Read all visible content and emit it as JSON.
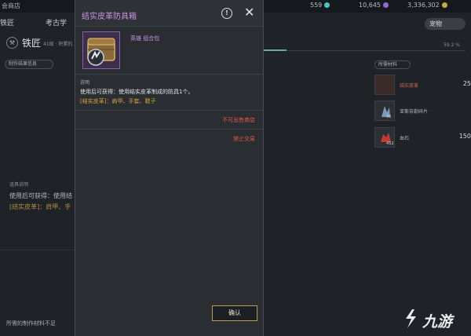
{
  "topbar": {
    "shop": "会商店",
    "resources": [
      {
        "value": "559",
        "color": "#4dc3c4"
      },
      {
        "value": "10,645",
        "color": "#8f6ad0"
      },
      {
        "value": "3,336,302",
        "color": "#c9a64a"
      }
    ]
  },
  "tabs": {
    "smith": "铁匠",
    "archaeology": "考古学",
    "pet": "宠物"
  },
  "smith": {
    "title": "铁匠",
    "level": "41级 · 积累的…",
    "icon": "⚒"
  },
  "result_button": "制作结果信息",
  "progress": {
    "percent_text": "59.2 %",
    "fraction": 0.592
  },
  "materials": {
    "header": "所需材料",
    "items": [
      {
        "name": "结实皮革",
        "count": "25",
        "qty": "",
        "name_color": "#d9635a"
      },
      {
        "name": "亚斯奈勒碎片",
        "count": "",
        "qty": "36",
        "name_color": "#b4b8bd"
      },
      {
        "name": "血石",
        "count": "150",
        "qty": "452",
        "name_color": "#b4b8bd"
      }
    ]
  },
  "background": {
    "desc_label": "道具说明",
    "line1": "使用后可获得：使用结",
    "line2": "[结实皮革]：肩甲、手",
    "bottom_notice": "所需的制作材料不足"
  },
  "modal": {
    "title": "结实皮革防具箱",
    "item_type": "英雄 组合包",
    "desc_label": "说明",
    "desc_line1": "使用后可获得：使用结实皮革制成的防具1个。",
    "desc_line2": "[结实皮革]：肩甲、手套、鞋子",
    "warning_shop": "不可出售商店",
    "warning_trade": "禁止交易",
    "confirm": "确认"
  },
  "logo": {
    "text": "九游"
  }
}
